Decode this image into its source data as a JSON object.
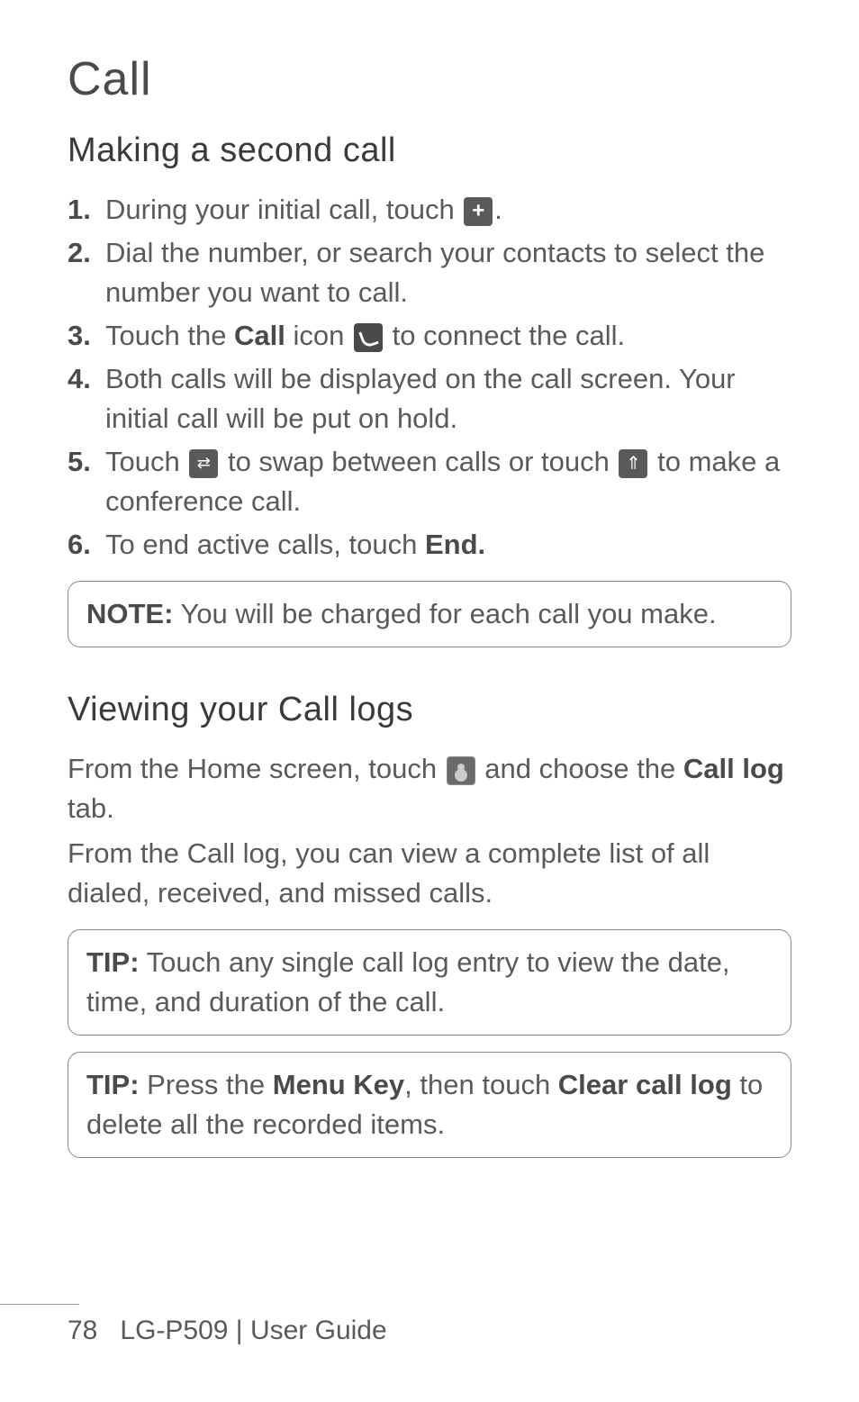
{
  "title": "Call",
  "section1": {
    "heading": "Making a second call",
    "items": [
      {
        "num": "1.",
        "pre": "During your initial call, touch ",
        "post": "."
      },
      {
        "num": "2.",
        "text": "Dial the number, or search your contacts to select the number you want to call."
      },
      {
        "num": "3.",
        "pre": "Touch the ",
        "bold": "Call",
        "mid": " icon ",
        "post": " to connect the call."
      },
      {
        "num": "4.",
        "text": "Both calls will be displayed on the call screen. Your initial call will be put on hold."
      },
      {
        "num": "5.",
        "pre": "Touch ",
        "mid": " to swap between calls or touch ",
        "post": " to make a conference call."
      },
      {
        "num": "6.",
        "pre": "To end active calls, touch ",
        "bold": "End."
      }
    ],
    "note_label": "NOTE:",
    "note_text": " You will be charged for each call you make."
  },
  "section2": {
    "heading": "Viewing your Call logs",
    "para1_pre": "From the Home screen, touch ",
    "para1_post": " and choose the ",
    "para1_bold": "Call log",
    "para1_end": " tab.",
    "para2": "From the Call log, you can view a complete list of all dialed, received, and missed calls.",
    "tip1_label": "TIP:",
    "tip1_text": " Touch any single call log entry to view the date, time, and duration of the call.",
    "tip2_label": "TIP:",
    "tip2_pre": " Press the ",
    "tip2_bold1": "Menu Key",
    "tip2_mid": ", then touch ",
    "tip2_bold2": "Clear call log",
    "tip2_end": " to delete all the recorded items."
  },
  "footer": {
    "page_num": "78",
    "model": "LG-P509",
    "divider": "  |  ",
    "label": "User Guide"
  }
}
